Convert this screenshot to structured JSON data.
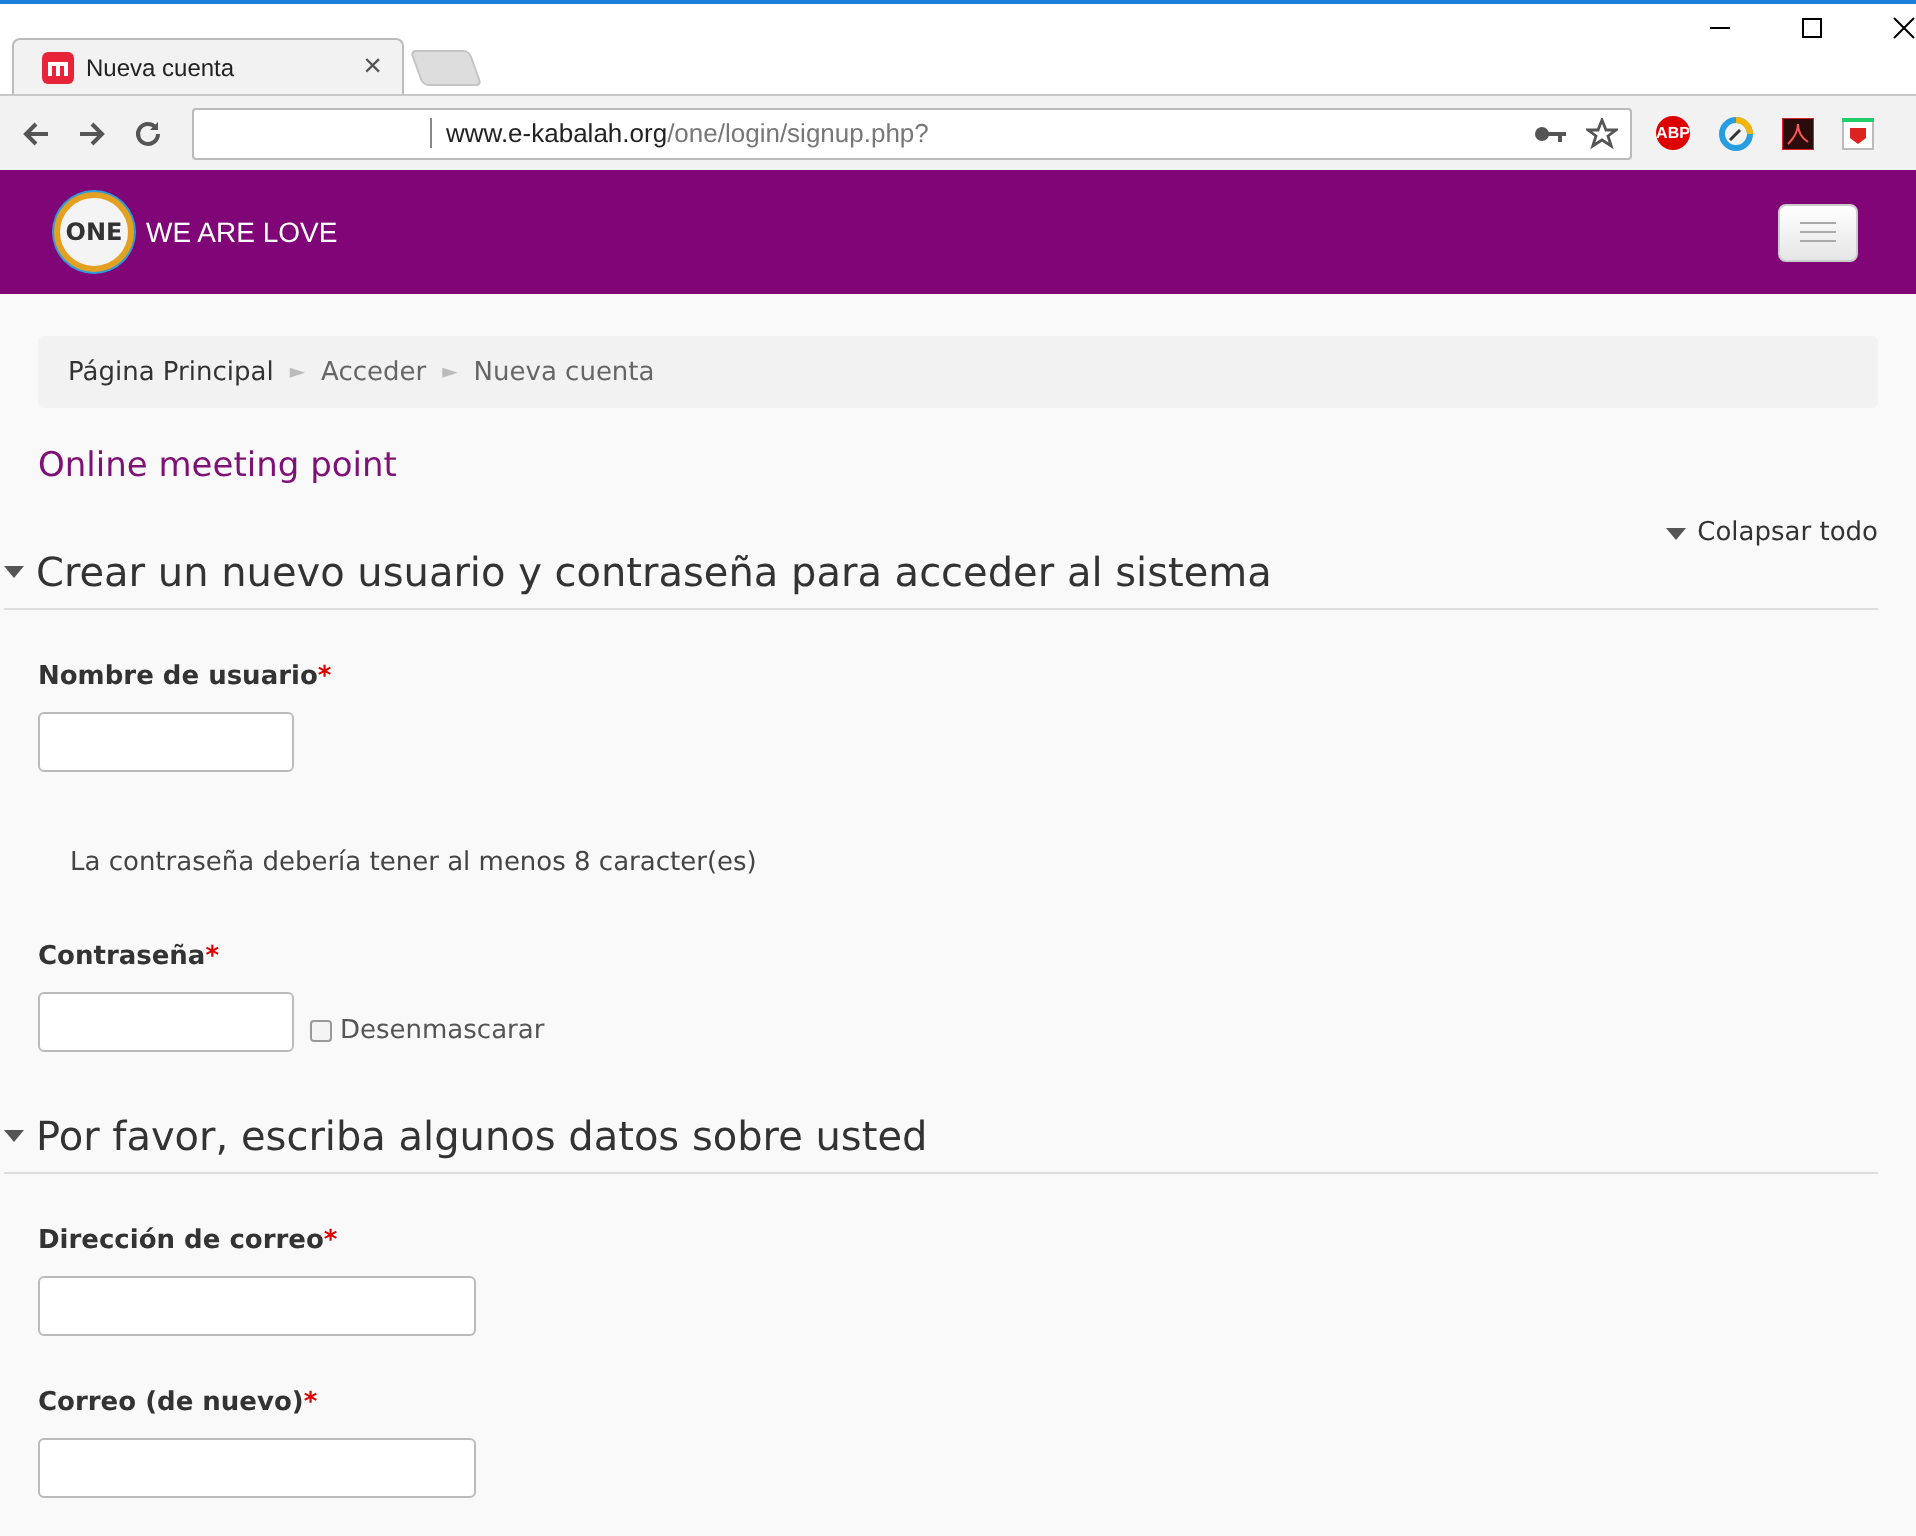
{
  "browser": {
    "tab": {
      "title": "Nueva cuenta",
      "close": "×"
    },
    "address": {
      "host": "www.e-kabalah.org",
      "path": "/one/login/signup.php?"
    },
    "extensions": [
      {
        "kind": "abp",
        "text": "ABP"
      },
      {
        "kind": "gauge"
      },
      {
        "kind": "pdf"
      },
      {
        "kind": "shield"
      }
    ]
  },
  "header": {
    "logo_text": "ONE",
    "tagline": "WE ARE LOVE"
  },
  "breadcrumbs": [
    {
      "label": "Página Principal",
      "sep": "►"
    },
    {
      "label": "Acceder",
      "sep": "►"
    },
    {
      "label": "Nueva cuenta"
    }
  ],
  "site_name": "Online meeting point",
  "collapse_all": "Colapsar todo",
  "sections": [
    {
      "title": "Crear un nuevo usuario y contraseña para acceder al sistema",
      "expanded": true,
      "fields": [
        {
          "kind": "text",
          "label": "Nombre de usuario",
          "required": true
        },
        {
          "kind": "note",
          "text": "La contraseña debería tener al menos 8 caracter(es)"
        },
        {
          "kind": "password",
          "label": "Contraseña",
          "required": true,
          "unmask": {
            "label": "Desenmascarar",
            "checked": false
          }
        }
      ]
    },
    {
      "title": "Por favor, escriba algunos datos sobre usted",
      "expanded": true,
      "fields": [
        {
          "kind": "wide_text",
          "label": "Dirección de correo",
          "required": true
        },
        {
          "kind": "wide_text",
          "label": "Correo (de nuevo)",
          "required": true
        }
      ]
    }
  ],
  "required_mark": "*"
}
